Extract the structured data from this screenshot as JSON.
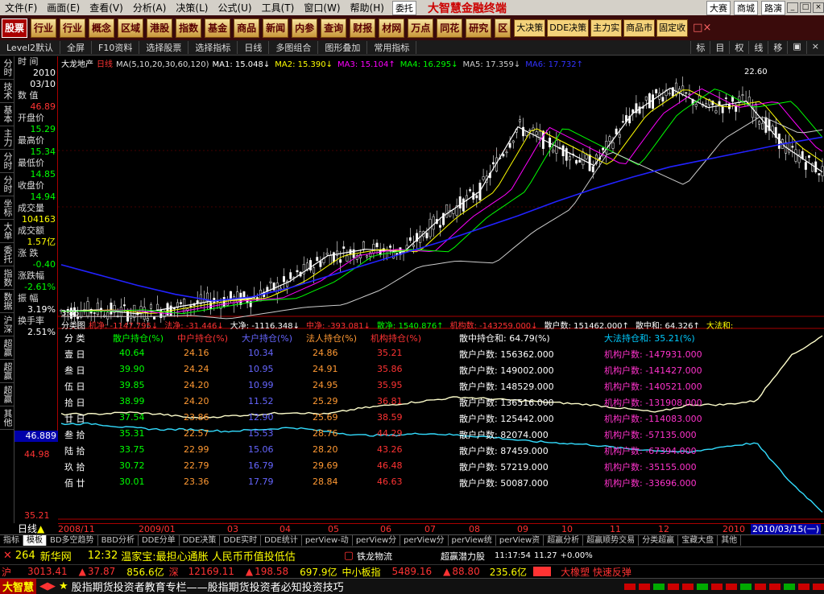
{
  "menu": [
    "文件(F)",
    "画面(E)",
    "查看(V)",
    "分析(A)",
    "决策(L)",
    "公式(U)",
    "工具(T)",
    "窗口(W)",
    "帮助(H)"
  ],
  "menu_btn": "委托",
  "brand": "大智慧金融终端",
  "menu_right": [
    "大赛",
    "商城",
    "路演"
  ],
  "toolbar": [
    "股票",
    "行业",
    "行业",
    "概念",
    "区域",
    "港股",
    "指数",
    "基金",
    "商品",
    "新闻",
    "内参",
    "查询",
    "财报",
    "材网",
    "万点",
    "同花",
    "研究",
    "区"
  ],
  "toolbar_right": [
    "大决策",
    "DDE决策",
    "主力实",
    "商品市",
    "固定收"
  ],
  "subbar": [
    "Level2默认",
    "全屏",
    "F10资料",
    "选择股票",
    "选择指标",
    "日线",
    "多图组合",
    "图形叠加",
    "常用指标"
  ],
  "subbar_right": [
    "标",
    "目",
    "权",
    "线",
    "移"
  ],
  "lefttabs": [
    "分时",
    "技术",
    "基本",
    "主力",
    "分时",
    "分时",
    "坐标",
    "大单",
    "委托",
    "指数",
    "数据",
    "沪深",
    "超赢",
    "超赢",
    "超赢",
    "其他"
  ],
  "info": [
    {
      "label": "时  间",
      "value": "2010",
      "color": "#fff"
    },
    {
      "label": "",
      "value": "03/10",
      "color": "#fff"
    },
    {
      "label": "数  值",
      "value": "46.89",
      "color": "#f33"
    },
    {
      "label": "开盘价",
      "value": "15.29",
      "color": "#0f0"
    },
    {
      "label": "最高价",
      "value": "15.34",
      "color": "#0f0"
    },
    {
      "label": "最低价",
      "value": "14.85",
      "color": "#0f0"
    },
    {
      "label": "收盘价",
      "value": "14.94",
      "color": "#0f0"
    },
    {
      "label": "成交量",
      "value": "104163",
      "color": "#ff0"
    },
    {
      "label": "成交额",
      "value": "1.57亿",
      "color": "#ff0"
    },
    {
      "label": "涨  跌",
      "value": "-0.40",
      "color": "#0f0"
    },
    {
      "label": "涨跌幅",
      "value": "-2.61%",
      "color": "#0f0"
    },
    {
      "label": "振  幅",
      "value": "3.19%",
      "color": "#fff"
    },
    {
      "label": "换手率",
      "value": "2.51%",
      "color": "#fff"
    }
  ],
  "price_box": "46.889",
  "ma_line": {
    "name": "大龙地产",
    "period": "日线",
    "params": "MA(5,10,20,30,60,120)",
    "ma": [
      {
        "t": "MA1: 15.048↓",
        "c": "#fff"
      },
      {
        "t": "MA2: 15.390↓",
        "c": "#ff0"
      },
      {
        "t": "MA3: 15.104↑",
        "c": "#f0f"
      },
      {
        "t": "MA4: 16.295↓",
        "c": "#0f0"
      },
      {
        "t": "MA5: 17.359↓",
        "c": "#ccc"
      },
      {
        "t": "MA6: 17.732↑",
        "c": "#33f"
      }
    ]
  },
  "price_labels": {
    "high": "22.60",
    "low": "3.86",
    "top_left": "226"
  },
  "fund_line": [
    {
      "t": "机净: -1147.795↓",
      "c": "#f33"
    },
    {
      "t": "法净: -31.446↓",
      "c": "#f33"
    },
    {
      "t": "大净: -1116.348↓",
      "c": "#fff"
    },
    {
      "t": "中净: -393.081↓",
      "c": "#f33"
    },
    {
      "t": "散净: 1540.876↑",
      "c": "#0f0"
    },
    {
      "t": "机构数: -143259.000↓",
      "c": "#f33"
    },
    {
      "t": "散户数: 151462.000↑",
      "c": "#fff"
    },
    {
      "t": "散中和: 64.326↑",
      "c": "#fff"
    },
    {
      "t": "大法和:",
      "c": "#ff0"
    }
  ],
  "fund_title": "分类图",
  "table": {
    "headers": [
      "分 类",
      "散户持仓(%)",
      "中户持仓(%)",
      "大户持仓(%)",
      "法人持仓(%)",
      "机构持仓(%)"
    ],
    "rows": [
      [
        "壹 日",
        "40.64",
        "24.16",
        "10.34",
        "24.86",
        "35.21"
      ],
      [
        "叁 日",
        "39.90",
        "24.24",
        "10.95",
        "24.91",
        "35.86"
      ],
      [
        "伍 日",
        "39.85",
        "24.20",
        "10.99",
        "24.95",
        "35.95"
      ],
      [
        "拾 日",
        "38.99",
        "24.20",
        "11.52",
        "25.29",
        "36.81"
      ],
      [
        "廿 日",
        "37.54",
        "23.86",
        "12.90",
        "25.69",
        "38.59"
      ],
      [
        "叁 拾",
        "35.31",
        "22.57",
        "15.53",
        "28.76",
        "44.29"
      ],
      [
        "陆 拾",
        "33.75",
        "22.99",
        "15.06",
        "28.20",
        "43.26"
      ],
      [
        "玖 拾",
        "30.72",
        "22.79",
        "16.79",
        "29.69",
        "46.48"
      ],
      [
        "佰 廿",
        "30.01",
        "23.36",
        "17.79",
        "28.84",
        "46.63"
      ]
    ],
    "scatter_header": "散中持仓和: 64.79(%)",
    "inst_header": "大法持仓和: 35.21(%)",
    "scatter": [
      "散户户数: 156362.000",
      "散户户数: 149002.000",
      "散户户数: 148529.000",
      "散户户数: 136516.000",
      "散户户数: 125442.000",
      "散户户数: 82074.000",
      "散户户数: 87459.000",
      "散户户数: 57219.000",
      "散户户数: 50087.000"
    ],
    "inst": [
      "机构户数: -147931.000",
      "机构户数: -141427.000",
      "机构户数: -140521.000",
      "机构户数: -131908.000",
      "机构户数: -114083.000",
      "机构户数: -57135.000",
      "机构户数: -67394.000",
      "机构户数: -35155.000",
      "机构户数: -33696.000"
    ]
  },
  "lower_labels": {
    "a": "44.98",
    "b": "35.21"
  },
  "dates": [
    "2008/11",
    "2009/01",
    "03",
    "04",
    "05",
    "06",
    "07",
    "08",
    "09",
    "10",
    "11",
    "12",
    "2010",
    "2010/03/15(一)"
  ],
  "period_label": "日线",
  "bottom_tabs": [
    "指标",
    "模板",
    "BD多空趋势",
    "BBD分析",
    "DDE分单",
    "DDE决策",
    "DDE实时",
    "DDE统计",
    "perView-动",
    "perView分",
    "perView分",
    "perView统",
    "perView资",
    "超赢分析",
    "超赢顺势交易",
    "分类超赢",
    "宝藏大盘",
    "其他"
  ],
  "news": {
    "code": "264",
    "source": "新华网",
    "time": "12:32",
    "text": "温家宝:最担心通胀 人民币币值投低估",
    "right1": "铁龙物流",
    "right2": "超赢潜力股",
    "clock": "11:17:54",
    "val": "11.27",
    "pct": "+0.00%"
  },
  "stat": {
    "sh": "沪",
    "sh_val": "3013.41",
    "sh_chg": "37.87",
    "sh_amt": "856.6亿",
    "sz": "深",
    "sz_val": "12169.11",
    "sz_chg": "198.58",
    "sz_amt": "697.9亿",
    "sme": "中小板指",
    "sme_val": "5489.16",
    "sme_chg": "88.80",
    "sme_amt": "235.6亿",
    "promo": "大橡塑 快速反弹"
  },
  "ticker": {
    "logo": "大智慧",
    "text": "股指期货投资者教育专栏——股指期货投资者必知投资技巧"
  },
  "chart_data": {
    "type": "line",
    "title": "大龙地产",
    "ylim": [
      3.86,
      22.6
    ],
    "series": [
      {
        "name": "MA1",
        "values": [
          4.2,
          4.3,
          4.0,
          4.5,
          5.0,
          5.2,
          6.5,
          8.5,
          9.0,
          8.8,
          11.5,
          13.5,
          18.5,
          17.0,
          15.5,
          19.5,
          21.5,
          20.0,
          20.5,
          17.0,
          15.0
        ]
      },
      {
        "name": "MA6",
        "values": [
          7.8,
          7.0,
          6.2,
          5.5,
          5.0,
          5.3,
          6.0,
          6.9,
          7.8,
          8.7,
          9.6,
          10.6,
          11.6,
          12.7,
          13.7,
          14.6,
          15.4,
          16.0,
          16.6,
          17.2,
          17.7
        ]
      }
    ]
  }
}
